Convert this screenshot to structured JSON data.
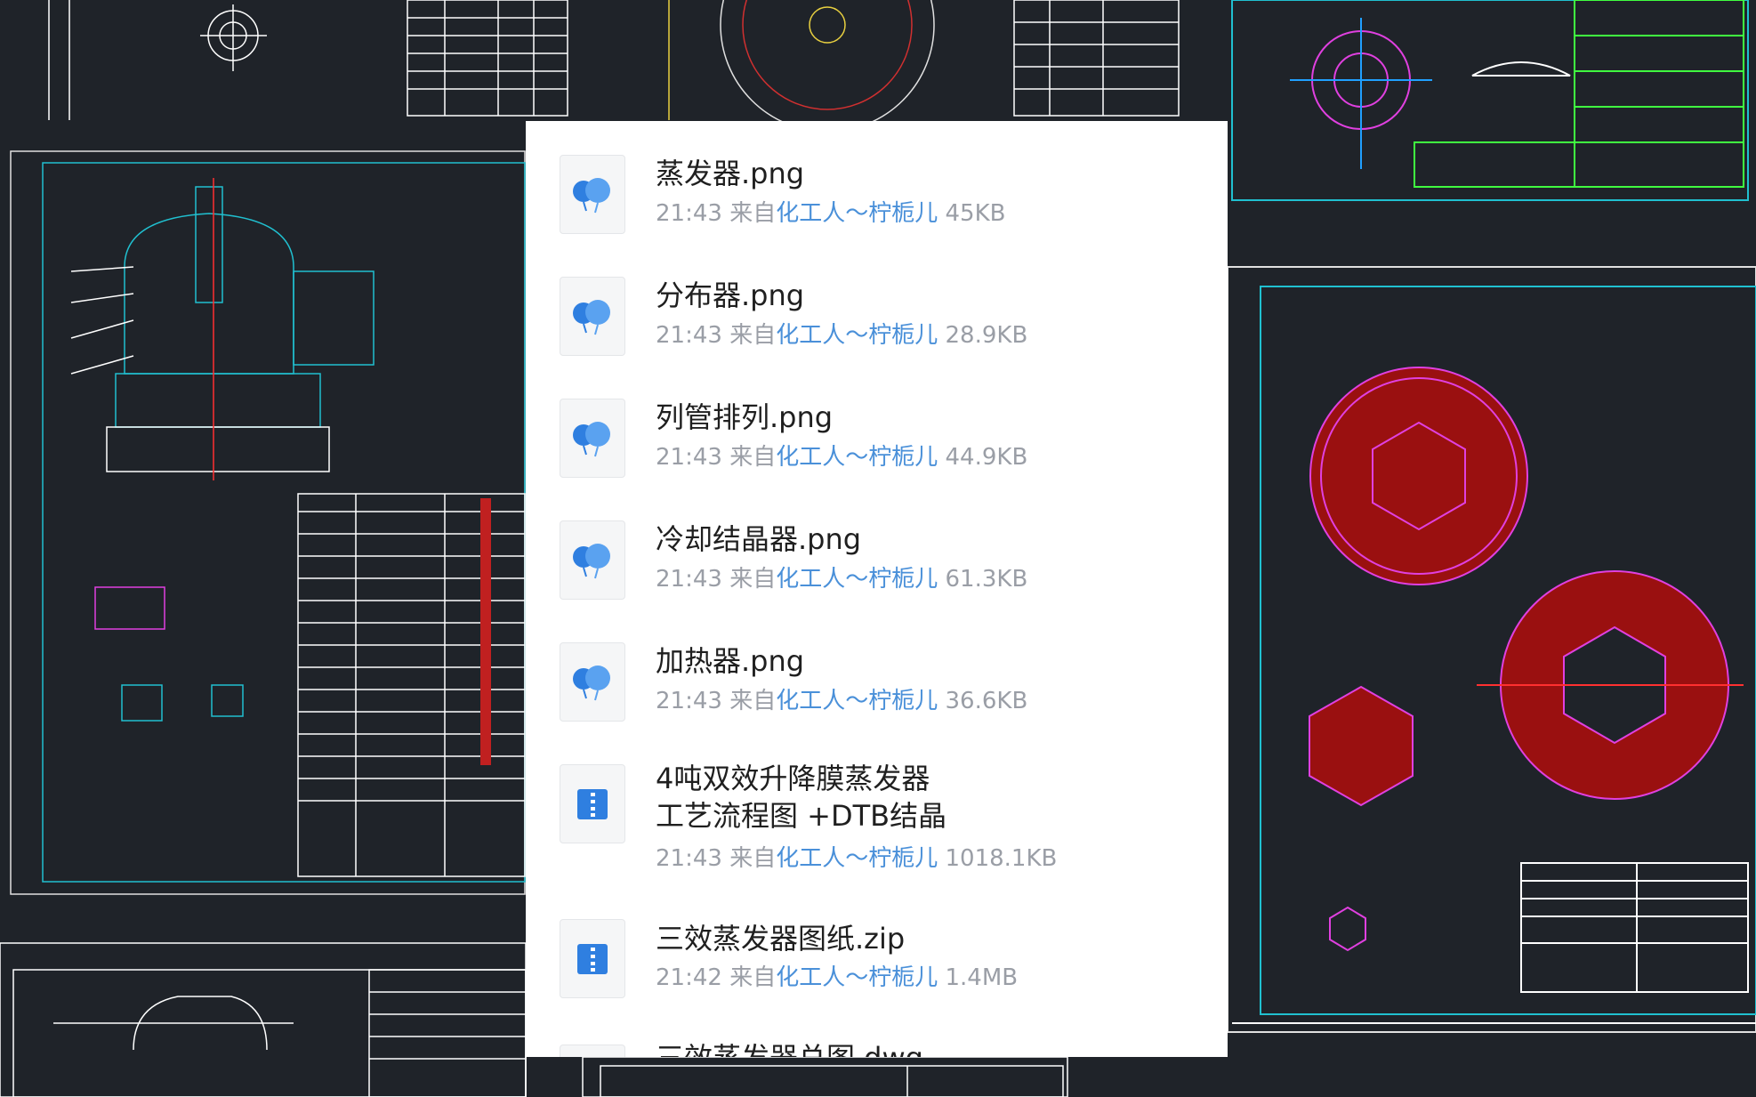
{
  "files": [
    {
      "name": "蒸发器.png",
      "time": "21:43",
      "from": "来自",
      "sender": "化工人～柠栀儿",
      "size": "45KB",
      "icon": "image-balloon-icon"
    },
    {
      "name": "分布器.png",
      "time": "21:43",
      "from": "来自",
      "sender": "化工人～柠栀儿",
      "size": "28.9KB",
      "icon": "image-balloon-icon"
    },
    {
      "name": "列管排列.png",
      "time": "21:43",
      "from": "来自",
      "sender": "化工人～柠栀儿",
      "size": "44.9KB",
      "icon": "image-balloon-icon"
    },
    {
      "name": "冷却结晶器.png",
      "time": "21:43",
      "from": "来自",
      "sender": "化工人～柠栀儿",
      "size": "61.3KB",
      "icon": "image-balloon-icon"
    },
    {
      "name": "加热器.png",
      "time": "21:43",
      "from": "来自",
      "sender": "化工人～柠栀儿",
      "size": "36.6KB",
      "icon": "image-balloon-icon"
    },
    {
      "name_line1": "4吨双效升降膜蒸发器",
      "name_line2": "工艺流程图 +DTB结晶",
      "time": "21:43",
      "from": "来自",
      "sender": "化工人～柠栀儿",
      "size": "1018.1KB",
      "icon": "zip-file-icon"
    },
    {
      "name": "三效蒸发器图纸.zip",
      "time": "21:42",
      "from": "来自",
      "sender": "化工人～柠栀儿",
      "size": "1.4MB",
      "icon": "zip-file-icon"
    },
    {
      "name": "三效蒸发器总图.dwg",
      "icon": "file-icon"
    }
  ],
  "colors": {
    "sender_link": "#4a90d9",
    "meta_gray": "#9a9ea6",
    "cad_background": "#1f2329",
    "image_icon": "#2f7fe0"
  }
}
